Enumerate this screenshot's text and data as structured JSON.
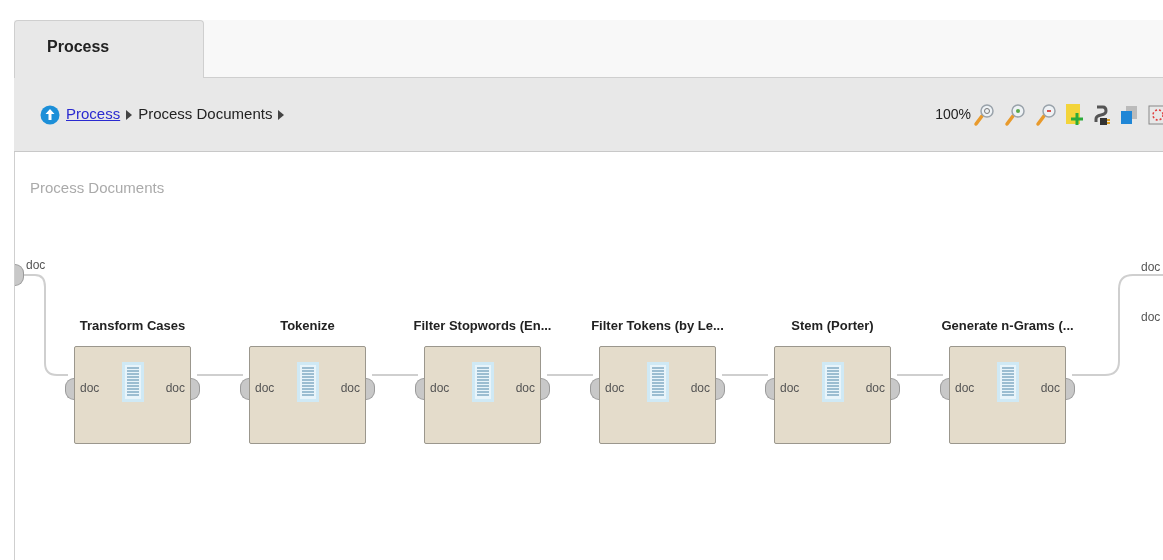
{
  "tabs": [
    {
      "label": "Process",
      "selected": true
    }
  ],
  "breadcrumb": [
    {
      "label": "Process",
      "kind": "link"
    },
    {
      "label": "Process Documents",
      "kind": "current"
    }
  ],
  "zoom": "100%",
  "canvas": {
    "title": "Process Documents",
    "input_port": "doc",
    "output_ports": [
      "doc",
      "doc"
    ],
    "operators": [
      {
        "title": "Transform Cases",
        "input": "doc",
        "output": "doc"
      },
      {
        "title": "Tokenize",
        "input": "doc",
        "output": "doc"
      },
      {
        "title": "Filter Stopwords (En...",
        "input": "doc",
        "output": "doc"
      },
      {
        "title": "Filter Tokens (by Le...",
        "input": "doc",
        "output": "doc"
      },
      {
        "title": "Stem (Porter)",
        "input": "doc",
        "output": "doc"
      },
      {
        "title": "Generate n-Grams (...",
        "input": "doc",
        "output": "doc"
      }
    ]
  }
}
